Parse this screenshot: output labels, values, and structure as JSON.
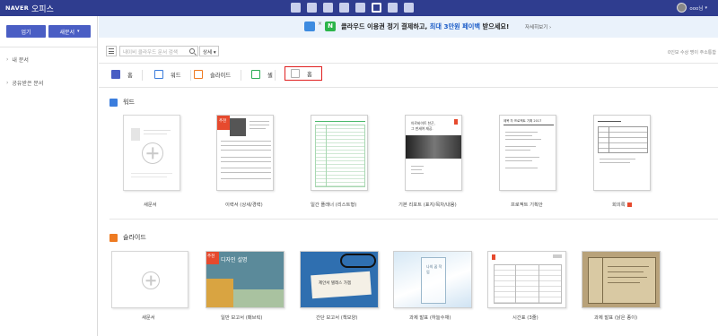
{
  "header": {
    "brand": "NAVER",
    "title": "오피스",
    "apps": [
      "mail-app-icon",
      "calendar-app-icon",
      "memo-app-icon",
      "contacts-app-icon",
      "cloud-app-icon",
      "office-app-icon",
      "blog-app-icon",
      "cafe-app-icon"
    ],
    "user_name": "ooo님",
    "colors": {
      "bar": "#2f3d8f",
      "accent": "#4a5ec4"
    }
  },
  "sidebar": {
    "upload_label": "업기",
    "new_doc_label": "새문서",
    "items": [
      {
        "label": "내 문서"
      },
      {
        "label": "공유받은 문서"
      }
    ]
  },
  "banner": {
    "text_before": "클라우드 이용권 정기 결제하고, ",
    "highlight": "최대 3만원 페이백",
    "text_after": " 받으세요!",
    "detail_link": "자세히보기",
    "x_sign": "×",
    "n_logo": "N"
  },
  "toolbar": {
    "search_placeholder": "내이비 클라우드 문서 검색",
    "detail_label": "상세"
  },
  "storage_text": "0인보 수상 명이 주소통합",
  "tabs": [
    {
      "label": "홈",
      "color": "#4a5ec4"
    },
    {
      "label": "워드",
      "color": "#3b7ddd"
    },
    {
      "label": "슬라이드",
      "color": "#ee7b22"
    },
    {
      "label": "셀",
      "color": "#2bae56"
    },
    {
      "label": "홈",
      "color": "#b0b0b0"
    }
  ],
  "word_section": {
    "title": "워드",
    "icon_color": "#3b7ddd",
    "templates": [
      {
        "label": "새문서"
      },
      {
        "label": "이력서 (상세/경력)"
      },
      {
        "label": "일간 플래너 (리스트형)"
      },
      {
        "label": "기본 리포트 (표지/목차/내용)"
      },
      {
        "label": "프로젝트 기획안"
      },
      {
        "label": "회의록"
      }
    ],
    "resume_tag": "추천",
    "report_cover": {
      "line1": "아르바이트 찬곤,",
      "line2": "그 딴세여 재공."
    },
    "plan_title": "제목 차 프로젝트 기획 2017"
  },
  "slide_section": {
    "title": "슬라이드",
    "icon_color": "#ee7b22",
    "templates": [
      {
        "label": "새문서"
      },
      {
        "label": "일반 보고서 (패브릭)"
      },
      {
        "label": "간단 보고서 (책모양)"
      },
      {
        "label": "과제 발표 (하늘수채)"
      },
      {
        "label": "시간표 (3줄)"
      },
      {
        "label": "과제 발표 (낡은 종이)"
      }
    ],
    "fabric_tag": "추천",
    "fabric_text": "디자인 설명",
    "book_text": "제안서 텔레스 가젬",
    "sky_text": "나의 꿈 작업"
  }
}
